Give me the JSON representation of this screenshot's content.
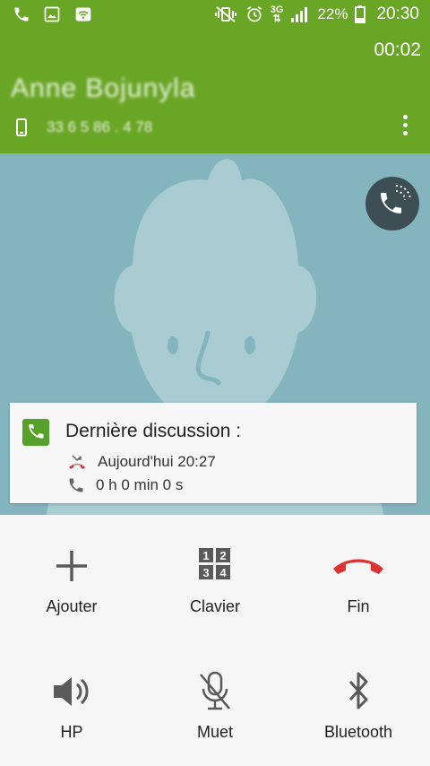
{
  "status_bar": {
    "battery": "22%",
    "network": "3G",
    "time": "20:30"
  },
  "call": {
    "timer": "00:02",
    "contact_name": "Anne Bojunyla",
    "phone_number": "33 6 5 86 . 4 78"
  },
  "last_discussion": {
    "title": "Dernière discussion :",
    "date": "Aujourd'hui 20:27",
    "duration": "0 h 0 min 0 s"
  },
  "actions": {
    "add": "Ajouter",
    "keypad": "Clavier",
    "end": "Fin",
    "speaker": "HP",
    "mute": "Muet",
    "bluetooth": "Bluetooth"
  },
  "keypad_digits": [
    "1",
    "2",
    "3",
    "4"
  ],
  "colors": {
    "header_green": "#6aa626",
    "avatar_bg": "#84b5bf",
    "end_red": "#e03131",
    "card_icon_green": "#57a12b"
  }
}
